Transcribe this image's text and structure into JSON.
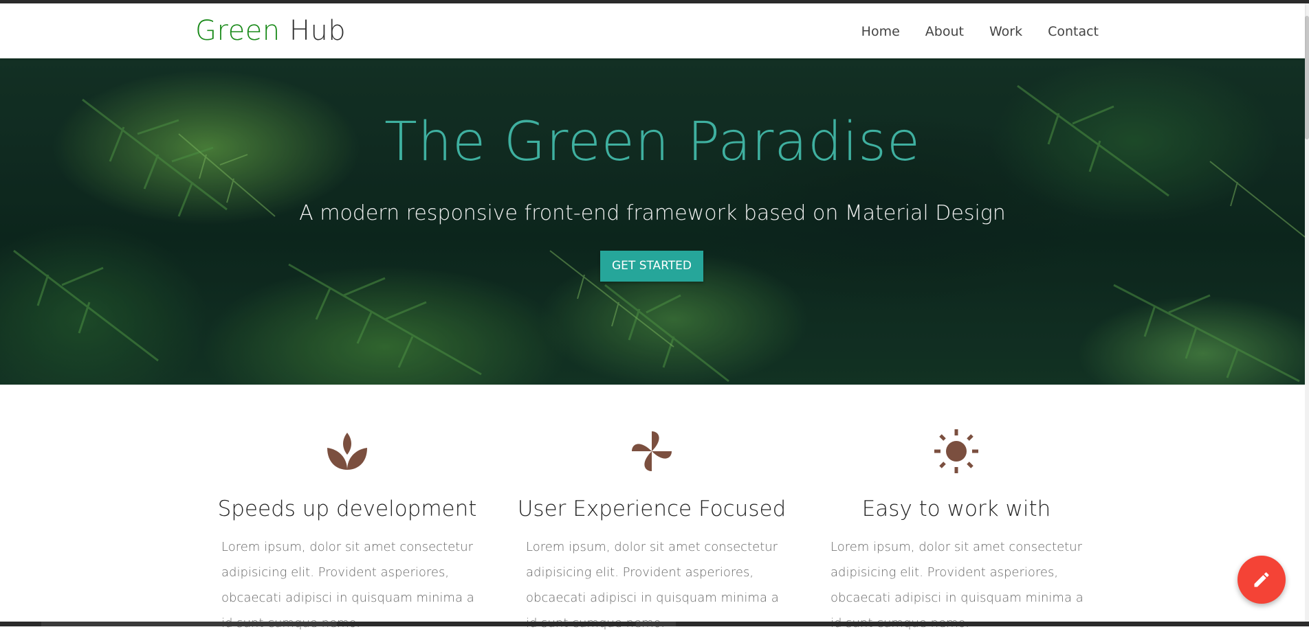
{
  "brand": {
    "part1": "Green",
    "part2": "Hub"
  },
  "nav": {
    "items": [
      "Home",
      "About",
      "Work",
      "Contact"
    ]
  },
  "hero": {
    "title": "The Green Paradise",
    "subtitle": "A modern responsive front-end framework based on Material Design",
    "cta_label": "GET STARTED"
  },
  "features": [
    {
      "icon": "spa-icon",
      "title": "Speeds up development",
      "text": "Lorem ipsum, dolor sit amet consectetur adipisicing elit. Provident asperiores, obcaecati adipisci in quisquam minima a id sunt cumque nemo."
    },
    {
      "icon": "pinwheel-icon",
      "title": "User Experience Focused",
      "text": "Lorem ipsum, dolor sit amet consectetur adipisicing elit. Provident asperiores, obcaecati adipisci in quisquam minima a id sunt cumque nemo."
    },
    {
      "icon": "sun-icon",
      "title": "Easy to work with",
      "text": "Lorem ipsum, dolor sit amet consectetur adipisicing elit. Provident asperiores, obcaecati adipisci in quisquam minima a id sunt cumque nemo."
    }
  ],
  "fab": {
    "icon": "pencil-icon"
  },
  "colors": {
    "brand_green": "#1a8a1a",
    "teal": "#26a69a",
    "hero_title": "#3fb0a0",
    "icon_brown": "#7b4f3f",
    "fab_red": "#f44336"
  }
}
